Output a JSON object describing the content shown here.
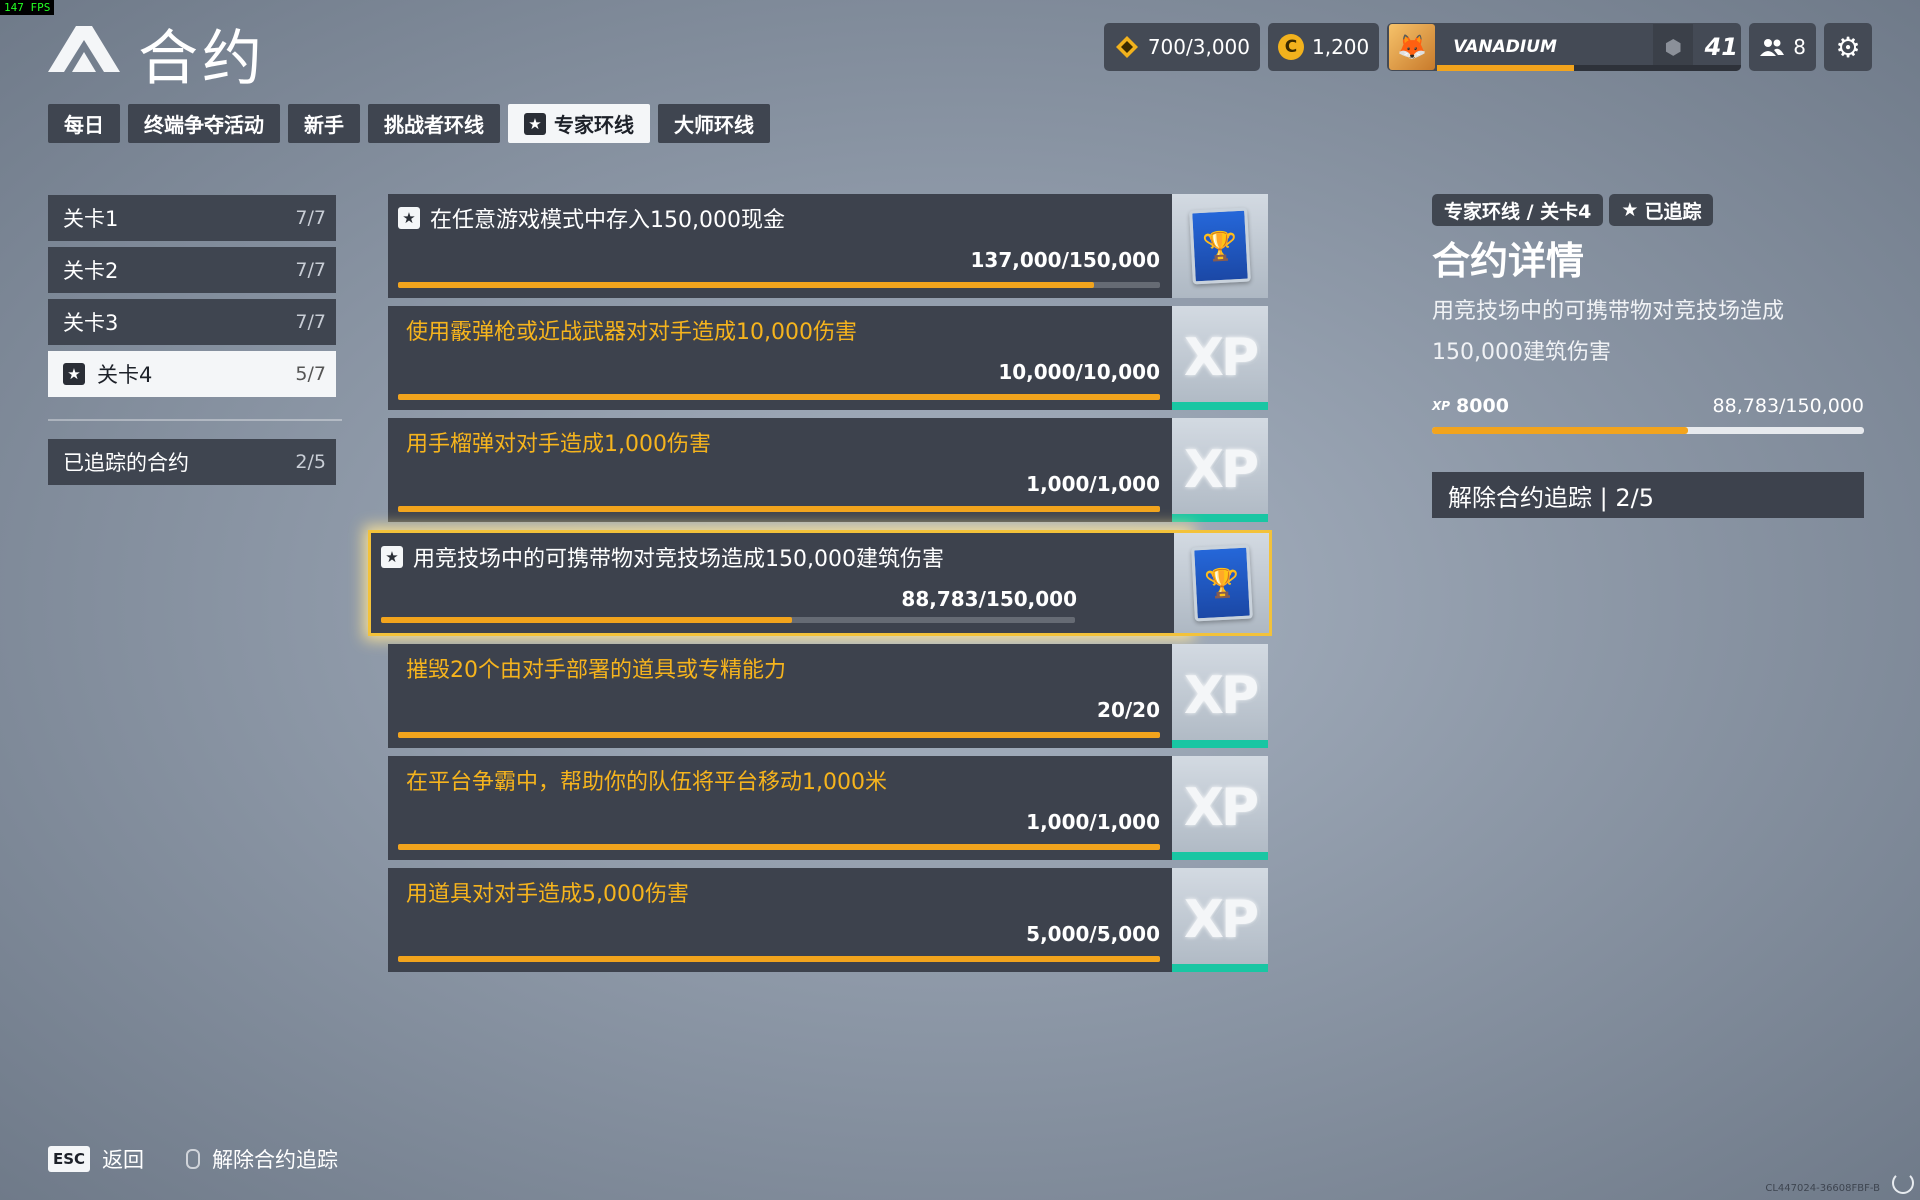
{
  "fps": "147 FPS",
  "header": {
    "title": "合约"
  },
  "topbar": {
    "tokens": "700/3,000",
    "coins": "1,200",
    "coin_symbol": "C",
    "player_name": "VANADIUM",
    "level": "41",
    "level_progress": 0.45,
    "friends": "8"
  },
  "tabs": [
    {
      "label": "每日"
    },
    {
      "label": "终端争夺活动"
    },
    {
      "label": "新手"
    },
    {
      "label": "挑战者环线"
    },
    {
      "label": "专家环线",
      "active": true
    },
    {
      "label": "大师环线"
    }
  ],
  "levels": [
    {
      "label": "关卡1",
      "count": "7/7"
    },
    {
      "label": "关卡2",
      "count": "7/7"
    },
    {
      "label": "关卡3",
      "count": "7/7"
    },
    {
      "label": "关卡4",
      "count": "5/7",
      "active": true
    }
  ],
  "tracked": {
    "label": "已追踪的合约",
    "count": "2/5"
  },
  "contracts": [
    {
      "title": "在任意游戏模式中存入150,000现金",
      "progress": "137,000/150,000",
      "fraction": 0.913,
      "reward": "trophy",
      "tracked": true
    },
    {
      "title": "使用霰弹枪或近战武器对对手造成10,000伤害",
      "progress": "10,000/10,000",
      "fraction": 1.0,
      "reward": "xp"
    },
    {
      "title": "用手榴弹对对手造成1,000伤害",
      "progress": "1,000/1,000",
      "fraction": 1.0,
      "reward": "xp"
    },
    {
      "title": "用竞技场中的可携带物对竞技场造成150,000建筑伤害",
      "progress": "88,783/150,000",
      "fraction": 0.592,
      "reward": "trophy",
      "tracked": true,
      "selected": true
    },
    {
      "title": "摧毁20个由对手部署的道具或专精能力",
      "progress": "20/20",
      "fraction": 1.0,
      "reward": "xp"
    },
    {
      "title": "在平台争霸中，帮助你的队伍将平台移动1,000米",
      "progress": "1,000/1,000",
      "fraction": 1.0,
      "reward": "xp"
    },
    {
      "title": "用道具对对手造成5,000伤害",
      "progress": "5,000/5,000",
      "fraction": 1.0,
      "reward": "xp"
    }
  ],
  "xp_label": "XP",
  "detail": {
    "breadcrumb": "专家环线 / 关卡4",
    "tracked_badge": "已追踪",
    "title": "合约详情",
    "description": "用竞技场中的可携带物对竞技场造成150,000建筑伤害",
    "xp_small": "XP",
    "xp_reward": "8000",
    "progress": "88,783/150,000",
    "fraction": 0.592,
    "untrack_button": "解除合约追踪 | 2/5"
  },
  "footer": {
    "esc_key": "ESC",
    "back_label": "返回",
    "untrack_label": "解除合约追踪"
  },
  "build_id": "CL447024-36608FBF-B",
  "colors": {
    "accent": "#f2a41d",
    "xp_teal": "#19c6a3",
    "highlight": "#f3c23a"
  }
}
